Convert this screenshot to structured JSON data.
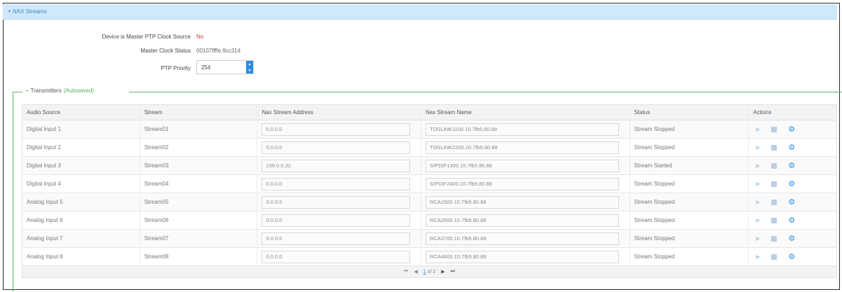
{
  "section": {
    "title": "NAX Streams",
    "caret": "▾"
  },
  "ptp": {
    "master_label": "Device is Master PTP Clock Source",
    "master_value": "No",
    "clock_label": "Master Clock Status",
    "clock_value": "00107ffffe.9cc314",
    "priority_label": "PTP Priority",
    "priority_value": "254"
  },
  "transmitters": {
    "collapse": "−",
    "label": "Transmitters",
    "autosaved": "(Autosaved)"
  },
  "table": {
    "columns": [
      "Audio Source",
      "Stream",
      "Nax Stream Address",
      "Nax Stream Name",
      "Status",
      "Actions"
    ],
    "rows": [
      {
        "source": "Digital Input 1",
        "stream": "Stream01",
        "address": "0.0.0.0",
        "name": "TOSLINK1100.10.7fb5.80.88",
        "status": "Stream Stopped"
      },
      {
        "source": "Digital Input 2",
        "stream": "Stream02",
        "address": "0.0.0.0",
        "name": "TOSLINK2200.10.7fb5.80.88",
        "status": "Stream Stopped"
      },
      {
        "source": "Digital Input 3",
        "stream": "Stream03",
        "address": "239.0.0.32",
        "name": "S/PDIF1300.10.7fb5.80.88",
        "status": "Stream Started"
      },
      {
        "source": "Digital Input 4",
        "stream": "Stream04",
        "address": "0.0.0.0",
        "name": "S/PDIF2400.10.7fb5.80.88",
        "status": "Stream Stopped"
      },
      {
        "source": "Analog Input 5",
        "stream": "Stream05",
        "address": "0.0.0.0",
        "name": "RCA1500.10.7fb5.80.88",
        "status": "Stream Stopped"
      },
      {
        "source": "Analog Input 6",
        "stream": "Stream06",
        "address": "0.0.0.0",
        "name": "RCA2600.10.7fb5.80.88",
        "status": "Stream Stopped"
      },
      {
        "source": "Analog Input 7",
        "stream": "Stream07",
        "address": "0.0.0.0",
        "name": "RCA3700.10.7fb5.80.88",
        "status": "Stream Stopped"
      },
      {
        "source": "Analog Input 8",
        "stream": "Stream08",
        "address": "0.0.0.0",
        "name": "RCA4800.10.7fb5.80.88",
        "status": "Stream Stopped"
      }
    ]
  },
  "pager": {
    "first": "⏮",
    "prev": "◀",
    "page": "1",
    "of": "of 2",
    "next": "▶",
    "last": "⏭"
  },
  "icons": {
    "play": "play-icon",
    "stop": "stop-icon",
    "settings": "gear-icon"
  },
  "colors": {
    "header_bg": "#cfe9fa",
    "accent": "#2b8ee6",
    "autosaved": "#4caf50",
    "no": "#c0392b"
  }
}
